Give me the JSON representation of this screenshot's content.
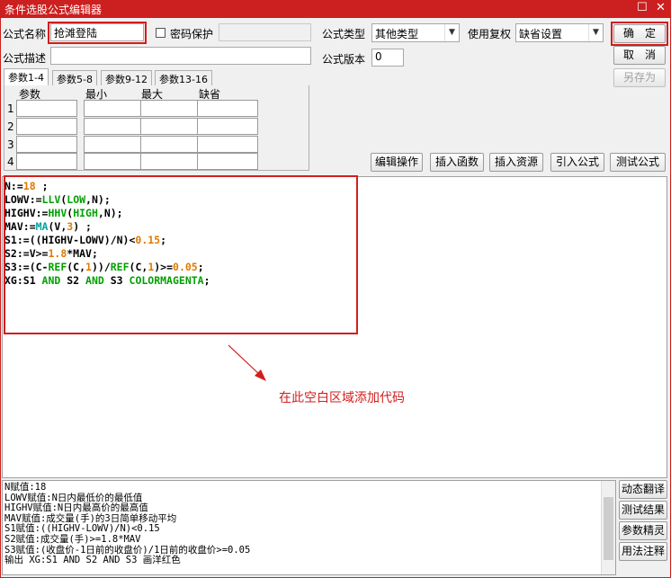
{
  "window": {
    "title": "条件选股公式编辑器",
    "restore_glyph": "☐",
    "close_glyph": "✕"
  },
  "form": {
    "name_label": "公式名称",
    "name_value": "抢滩登陆",
    "password_label": "密码保护",
    "type_label": "公式类型",
    "type_value": "其他类型",
    "reweight_label": "使用复权",
    "reweight_value": "缺省设置",
    "desc_label": "公式描述",
    "version_label": "公式版本",
    "version_value": "0"
  },
  "buttons": {
    "confirm": "确　定",
    "cancel": "取　消",
    "save_as": "另存为",
    "edit_ops": "编辑操作",
    "insert_func": "插入函数",
    "insert_resource": "插入资源",
    "import_formula": "引入公式",
    "test_formula": "测试公式"
  },
  "tabs": [
    "参数1-4",
    "参数5-8",
    "参数9-12",
    "参数13-16"
  ],
  "param_headers": [
    "参数",
    "最小",
    "最大",
    "缺省"
  ],
  "param_rows": [
    "1",
    "2",
    "3",
    "4"
  ],
  "code_lines": [
    [
      {
        "t": "N:=",
        "c": "k"
      },
      {
        "t": "18",
        "c": "n"
      },
      {
        "t": " ;",
        "c": "k"
      }
    ],
    [
      {
        "t": "LOWV:=",
        "c": "k"
      },
      {
        "t": "LLV",
        "c": "f"
      },
      {
        "t": "(",
        "c": "k"
      },
      {
        "t": "LOW",
        "c": "f"
      },
      {
        "t": ",N);",
        "c": "k"
      }
    ],
    [
      {
        "t": "HIGHV:=",
        "c": "k"
      },
      {
        "t": "HHV",
        "c": "f"
      },
      {
        "t": "(",
        "c": "k"
      },
      {
        "t": "HIGH",
        "c": "f"
      },
      {
        "t": ",N);",
        "c": "k"
      }
    ],
    [
      {
        "t": "MAV:=",
        "c": "k"
      },
      {
        "t": "MA",
        "c": "c"
      },
      {
        "t": "(V,",
        "c": "k"
      },
      {
        "t": "3",
        "c": "n"
      },
      {
        "t": ") ;",
        "c": "k"
      }
    ],
    [
      {
        "t": "S1:=((HIGHV-LOWV)/N)<",
        "c": "k"
      },
      {
        "t": "0.15",
        "c": "n"
      },
      {
        "t": ";",
        "c": "k"
      }
    ],
    [
      {
        "t": "S2:=V>=",
        "c": "k"
      },
      {
        "t": "1.8",
        "c": "n"
      },
      {
        "t": "*MAV;",
        "c": "k"
      }
    ],
    [
      {
        "t": "S3:=(C-",
        "c": "k"
      },
      {
        "t": "REF",
        "c": "f"
      },
      {
        "t": "(C,",
        "c": "k"
      },
      {
        "t": "1",
        "c": "n"
      },
      {
        "t": "))/",
        "c": "k"
      },
      {
        "t": "REF",
        "c": "f"
      },
      {
        "t": "(C,",
        "c": "k"
      },
      {
        "t": "1",
        "c": "n"
      },
      {
        "t": ")>=",
        "c": "k"
      },
      {
        "t": "0.05",
        "c": "n"
      },
      {
        "t": ";",
        "c": "k"
      }
    ],
    [
      {
        "t": "XG:S1 ",
        "c": "k"
      },
      {
        "t": "AND",
        "c": "f"
      },
      {
        "t": " S2 ",
        "c": "k"
      },
      {
        "t": "AND",
        "c": "f"
      },
      {
        "t": " S3 ",
        "c": "k"
      },
      {
        "t": "COLORMAGENTA",
        "c": "f"
      },
      {
        "t": ";",
        "c": "k"
      }
    ]
  ],
  "annotation": "在此空白区域添加代码",
  "output_lines": [
    "N赋值:18",
    "LOWV赋值:N日内最低价的最低值",
    "HIGHV赋值:N日内最高价的最高值",
    "MAV赋值:成交量(手)的3日简单移动平均",
    "S1赋值:((HIGHV-LOWV)/N)<0.15",
    "S2赋值:成交量(手)>=1.8*MAV",
    "S3赋值:(收盘价-1日前的收盘价)/1日前的收盘价>=0.05",
    "输出 XG:S1 AND S2 AND S3 画洋红色"
  ],
  "side_buttons": [
    "动态翻译",
    "测试结果",
    "参数精灵",
    "用法注释"
  ],
  "colors": {
    "title_bar": "#cc1f1f",
    "highlight_box": "#d21e1e",
    "annotation": "#d21e1e"
  }
}
